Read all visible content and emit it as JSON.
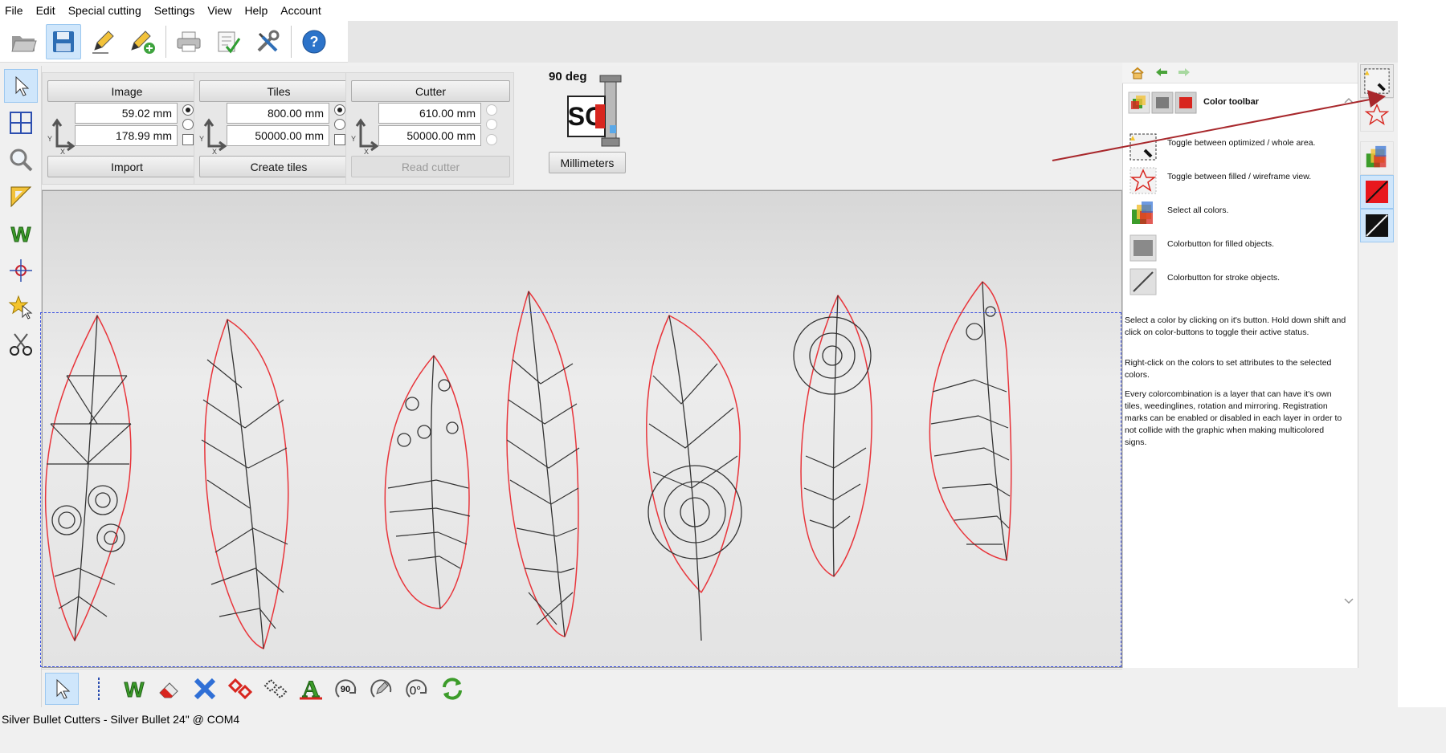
{
  "menu": [
    "File",
    "Edit",
    "Special cutting",
    "Settings",
    "View",
    "Help",
    "Account"
  ],
  "image_group": {
    "title": "Image",
    "x_value": "59.02 mm",
    "y_value": "178.99 mm",
    "action": "Import"
  },
  "tiles_group": {
    "title": "Tiles",
    "x_value": "800.00 mm",
    "y_value": "50000.00 mm",
    "action": "Create tiles"
  },
  "cutter_group": {
    "title": "Cutter",
    "x_value": "610.00 mm",
    "y_value": "50000.00 mm",
    "action": "Read cutter"
  },
  "rotation_label": "90 deg",
  "logo_text": "SC",
  "units_button": "Millimeters",
  "help": {
    "header": "Color toolbar",
    "items": [
      {
        "icon": "optimized-area-icon",
        "text": "Toggle between optimized / whole area."
      },
      {
        "icon": "star-outline-icon",
        "text": "Toggle between filled / wireframe view."
      },
      {
        "icon": "select-all-colors-icon",
        "text": "Select all colors."
      },
      {
        "icon": "fill-color-icon",
        "text": "Colorbutton for filled objects."
      },
      {
        "icon": "stroke-color-icon",
        "text": "Colorbutton for stroke objects."
      }
    ],
    "paragraph1": "Select a color by clicking on it's button. Hold down shift and click on color-buttons to toggle their active status.",
    "paragraph2": "Right-click on the colors to set attributes to the selected colors.",
    "paragraph3": "Every colorcombination is a layer that can have it's own tiles, weedinglines, rotation and mirroring. Registration marks can be enabled or disabled in each layer in order to not collide with the graphic when making multicolored signs."
  },
  "bottom_tool_labels": {
    "rotate90": "90",
    "rotate0": "0°"
  },
  "status": "Silver Bullet Cutters - Silver Bullet 24\" @ COM4",
  "colors": {
    "accent": "#cfe6fb",
    "stroke_red": "#e8353b",
    "arrow": "#a8282c",
    "selection": "#3a4fe0"
  }
}
